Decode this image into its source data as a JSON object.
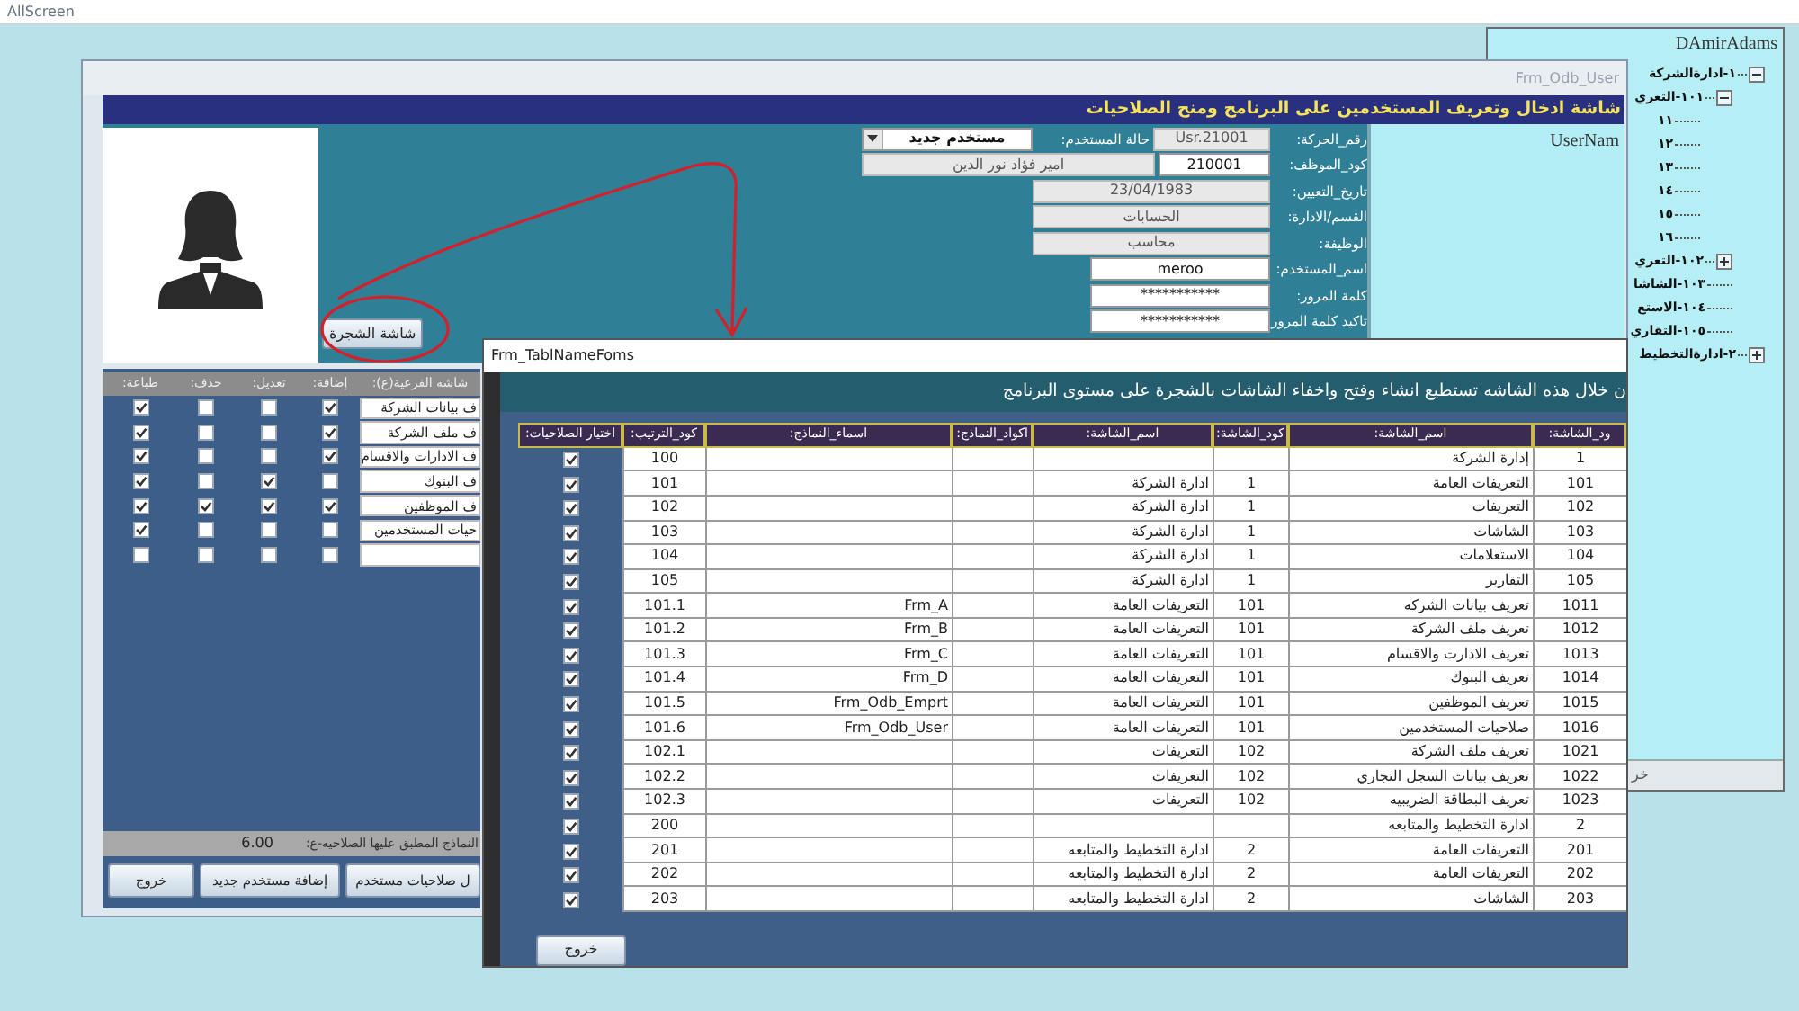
{
  "screen_title": "AllScreen",
  "tree_window": {
    "user": "DAmirAdams",
    "items": [
      {
        "label": "١-ادارةالشركة",
        "expanded": true,
        "children": [
          {
            "label": "١٠١-التعري",
            "expanded": true,
            "children": [
              {
                "label": "١١"
              },
              {
                "label": "١٢"
              },
              {
                "label": "١٣"
              },
              {
                "label": "١٤"
              },
              {
                "label": "١٥"
              },
              {
                "label": "١٦"
              }
            ]
          },
          {
            "label": "١٠٢-التعري",
            "expanded": false
          },
          {
            "label": "١٠٣-الشاشا"
          },
          {
            "label": "١٠٤-الاستع"
          },
          {
            "label": "١٠٥-التقاري"
          }
        ]
      },
      {
        "label": "٢-ادارةالتخطيط",
        "expanded": false
      }
    ],
    "bottom_button": "خر"
  },
  "main_form": {
    "title": "Frm_Odb_User",
    "header": "شاشة ادخال وتعريف المستخدمين على البرنامج ومنح الصلاحيات",
    "tree_button": "شاشة الشجرة",
    "user_panel_label": "UserNam",
    "form_rows": [
      {
        "label": "رقم_الحركة:",
        "controls": [
          {
            "kind": "readonly",
            "value": "Usr.21001"
          },
          {
            "kind": "label",
            "value": "حالة المستخدم:"
          },
          {
            "kind": "select",
            "value": "مستخدم جديد"
          }
        ]
      },
      {
        "label": "كود_الموظف:",
        "controls": [
          {
            "kind": "input",
            "value": "210001"
          },
          {
            "kind": "readonly",
            "value": "امير فؤاد نور الدين"
          }
        ]
      },
      {
        "label": "تاريخ_التعيين:",
        "controls": [
          {
            "kind": "readonly",
            "value": "23/04/1983"
          }
        ]
      },
      {
        "label": "القسم/الادارة:",
        "controls": [
          {
            "kind": "readonly",
            "value": "الحسابات"
          }
        ]
      },
      {
        "label": "الوظيفة:",
        "controls": [
          {
            "kind": "readonly",
            "value": "محاسب"
          }
        ]
      },
      {
        "label": "اسم_المستخدم:",
        "controls": [
          {
            "kind": "input",
            "value": "meroo"
          }
        ]
      },
      {
        "label": "كلمة المرور:",
        "controls": [
          {
            "kind": "input",
            "value": "***********"
          }
        ]
      },
      {
        "label": "تاكيد كلمة المرور:",
        "controls": [
          {
            "kind": "input",
            "value": "***********"
          }
        ]
      }
    ],
    "permissions": {
      "columns": [
        "شاشه الفرعية(ع):",
        "إضافة:",
        "تعديل:",
        "حذف:",
        "طباعة:"
      ],
      "rows": [
        {
          "name": "ف بيانات الشركة",
          "add": true,
          "edit": false,
          "delete": false,
          "print": true
        },
        {
          "name": "ف ملف الشركة",
          "add": true,
          "edit": false,
          "delete": false,
          "print": true
        },
        {
          "name": "ف الادارات والاقسام",
          "add": true,
          "edit": false,
          "delete": false,
          "print": true
        },
        {
          "name": "ف البنوك",
          "add": false,
          "edit": true,
          "delete": false,
          "print": true
        },
        {
          "name": "ف الموظفين",
          "add": true,
          "edit": true,
          "delete": true,
          "print": true
        },
        {
          "name": "حيات المستخدمين",
          "add": false,
          "edit": false,
          "delete": false,
          "print": true
        },
        {
          "name": "",
          "add": false,
          "edit": false,
          "delete": false,
          "print": false
        }
      ]
    },
    "count_label": "النماذج المطبق عليها الصلاحيه-ع:",
    "count": "6.00",
    "buttons": [
      "ل صلاحيات مستخدم",
      "إضافة مستخدم جديد",
      "خروج"
    ]
  },
  "dialog": {
    "title": "Frm_TablNameFoms",
    "banner": "ن خلال هذه الشاشه تستطيع انشاء وفتح واخفاء الشاشات بالشجرة على مستوى البرنامج",
    "columns": [
      "ود_الشاشة:",
      "اسم_الشاشة:",
      "كود_الشاشة:",
      "اسم_الشاشة:",
      "اكواد_النماذج:",
      "اسماء_النماذج:",
      "كود_الترتيب:",
      "اختيار الصلاحيات:"
    ],
    "rows": [
      {
        "cells": [
          "1",
          "إدارة الشركة",
          "",
          "",
          "",
          "",
          "100"
        ],
        "checked": true
      },
      {
        "cells": [
          "101",
          "التعريفات العامة",
          "1",
          "ادارة الشركة",
          "",
          "",
          "101"
        ],
        "checked": true
      },
      {
        "cells": [
          "102",
          "التعريفات",
          "1",
          "ادارة الشركة",
          "",
          "",
          "102"
        ],
        "checked": true
      },
      {
        "cells": [
          "103",
          "الشاشات",
          "1",
          "ادارة الشركة",
          "",
          "",
          "103"
        ],
        "checked": true
      },
      {
        "cells": [
          "104",
          "الاستعلامات",
          "1",
          "ادارة الشركة",
          "",
          "",
          "104"
        ],
        "checked": true
      },
      {
        "cells": [
          "105",
          "التقارير",
          "1",
          "ادارة الشركة",
          "",
          "",
          "105"
        ],
        "checked": true
      },
      {
        "cells": [
          "1011",
          "تعريف بيانات الشركه",
          "101",
          "التعريفات العامة",
          "",
          "Frm_A",
          "101.1"
        ],
        "checked": true
      },
      {
        "cells": [
          "1012",
          "تعريف ملف الشركة",
          "101",
          "التعريفات العامة",
          "",
          "Frm_B",
          "101.2"
        ],
        "checked": true
      },
      {
        "cells": [
          "1013",
          "تعريف الادارت والاقسام",
          "101",
          "التعريفات العامة",
          "",
          "Frm_C",
          "101.3"
        ],
        "checked": true
      },
      {
        "cells": [
          "1014",
          "تعريف البنوك",
          "101",
          "التعريفات العامة",
          "",
          "Frm_D",
          "101.4"
        ],
        "checked": true
      },
      {
        "cells": [
          "1015",
          "تعريف الموظفين",
          "101",
          "التعريفات العامة",
          "",
          "Frm_Odb_Emprt",
          "101.5"
        ],
        "checked": true
      },
      {
        "cells": [
          "1016",
          "صلاحيات المستخدمين",
          "101",
          "التعريفات العامة",
          "",
          "Frm_Odb_User",
          "101.6"
        ],
        "checked": true
      },
      {
        "cells": [
          "1021",
          "تعريف ملف الشركة",
          "102",
          "التعريفات",
          "",
          "",
          "102.1"
        ],
        "checked": true
      },
      {
        "cells": [
          "1022",
          "تعريف بيانات السجل التجاري",
          "102",
          "التعريفات",
          "",
          "",
          "102.2"
        ],
        "checked": true
      },
      {
        "cells": [
          "1023",
          "تعريف البطاقة الضريبيه",
          "102",
          "التعريفات",
          "",
          "",
          "102.3"
        ],
        "checked": true
      },
      {
        "cells": [
          "2",
          "ادارة التخطيط والمتابعه",
          "",
          "",
          "",
          "",
          "200"
        ],
        "checked": true
      },
      {
        "cells": [
          "201",
          "التعريفات العامة",
          "2",
          "ادارة التخطيط والمتابعه",
          "",
          "",
          "201"
        ],
        "checked": true
      },
      {
        "cells": [
          "202",
          "التعريفات العامة",
          "2",
          "ادارة التخطيط والمتابعه",
          "",
          "",
          "202"
        ],
        "checked": true
      },
      {
        "cells": [
          "203",
          "الشاشات",
          "2",
          "ادارة التخطيط والمتابعه",
          "",
          "",
          "203"
        ],
        "checked": true
      }
    ],
    "exit_button": "خروج"
  }
}
